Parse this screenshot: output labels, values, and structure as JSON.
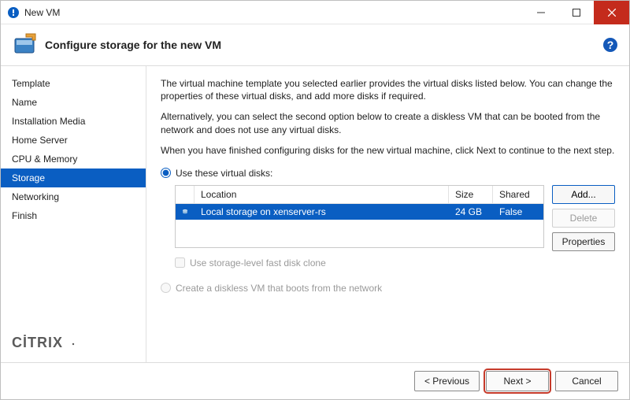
{
  "window": {
    "title": "New VM"
  },
  "header": {
    "title": "Configure storage for the new VM"
  },
  "sidebar": {
    "items": [
      {
        "label": "Template"
      },
      {
        "label": "Name"
      },
      {
        "label": "Installation Media"
      },
      {
        "label": "Home Server"
      },
      {
        "label": "CPU & Memory"
      },
      {
        "label": "Storage"
      },
      {
        "label": "Networking"
      },
      {
        "label": "Finish"
      }
    ],
    "activeIndex": 5,
    "brand": "CİTRIX"
  },
  "main": {
    "instr1": "The virtual machine template you selected earlier provides the virtual disks listed below. You can change the properties of these virtual disks, and add more disks if required.",
    "instr2": "Alternatively, you can select the second option below to create a diskless VM that can be booted from the network and does not use any virtual disks.",
    "instr3": "When you have finished configuring disks for the new virtual machine, click Next to continue to the next step.",
    "radio_disks": "Use these virtual disks:",
    "radio_diskless": "Create a diskless VM that boots from the network",
    "checkbox_fastclone": "Use storage-level fast disk clone",
    "table": {
      "headers": {
        "location": "Location",
        "size": "Size",
        "shared": "Shared"
      },
      "rows": [
        {
          "location": "Local storage on xenserver-rs",
          "size": "24 GB",
          "shared": "False"
        }
      ]
    },
    "buttons": {
      "add": "Add...",
      "delete": "Delete",
      "properties": "Properties"
    }
  },
  "footer": {
    "previous": "< Previous",
    "next": "Next >",
    "cancel": "Cancel"
  }
}
